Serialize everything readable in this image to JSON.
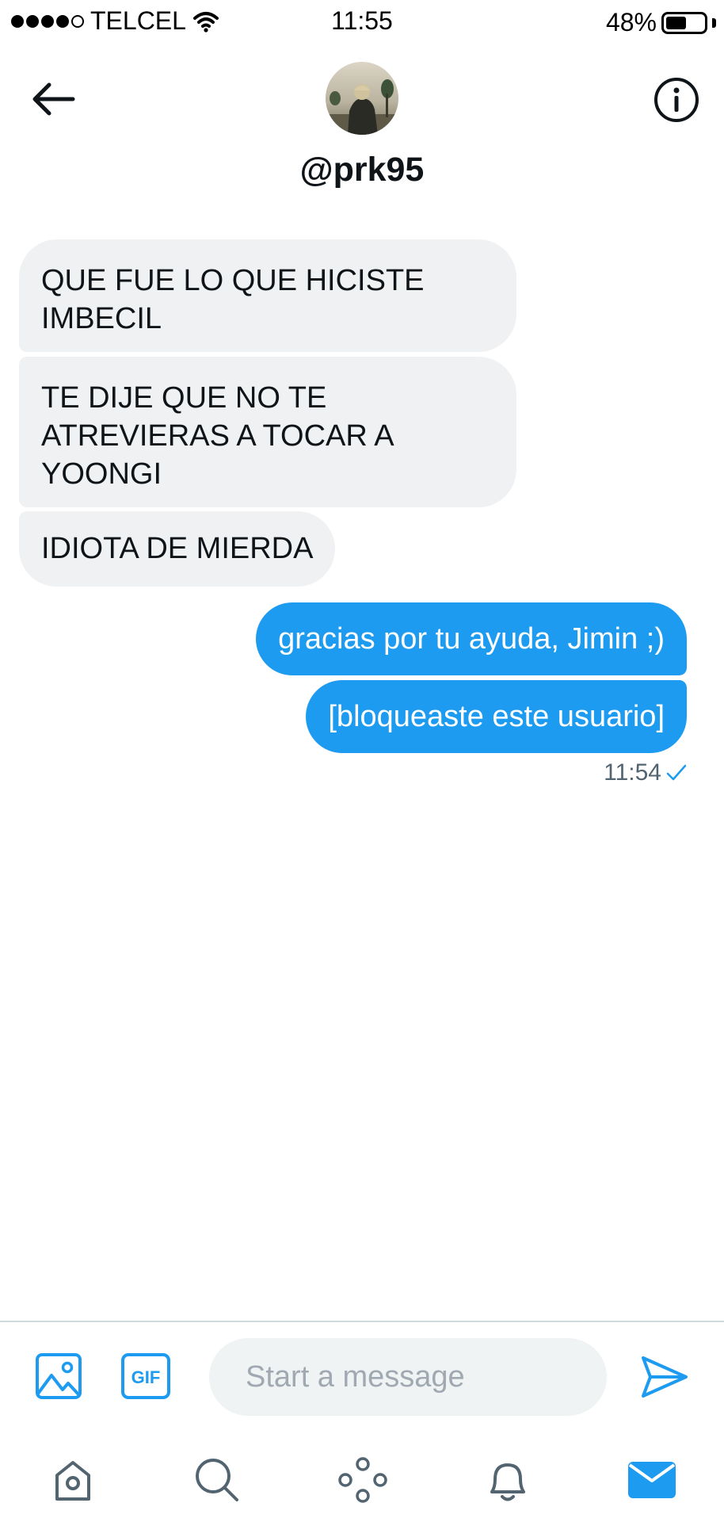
{
  "status_bar": {
    "carrier": "TELCEL",
    "time": "11:55",
    "battery": "48%",
    "battery_level": 0.48,
    "signal_bars_filled": 4,
    "signal_bars_total": 5
  },
  "header": {
    "handle": "@prk95",
    "back_icon": "arrow-left-icon",
    "info_icon": "info-icon"
  },
  "messages": [
    {
      "direction": "received",
      "text": "QUE FUE LO QUE HICISTE IMBECIL"
    },
    {
      "direction": "received",
      "text": "TE DIJE QUE NO TE ATREVIERAS A TOCAR A YOONGI"
    },
    {
      "direction": "received",
      "text": "IDIOTA DE MIERDA"
    },
    {
      "direction": "sent",
      "text": "gracias por tu ayuda, Jimin ;)"
    },
    {
      "direction": "sent",
      "text": "[bloqueaste este usuario]"
    }
  ],
  "last_sent": {
    "time": "11:54",
    "status_icon": "check-icon"
  },
  "composer": {
    "placeholder": "Start a message",
    "value": "",
    "gif_label": "GIF",
    "image_icon": "image-icon",
    "send_icon": "send-icon"
  },
  "nav": [
    "home-icon",
    "search-icon",
    "spaces-icon",
    "notifications-icon",
    "messages-icon"
  ],
  "colors": {
    "accent": "#1d9bf0",
    "received_bubble": "#eff1f3",
    "icon_dark": "#536471",
    "text": "#0f1419"
  }
}
